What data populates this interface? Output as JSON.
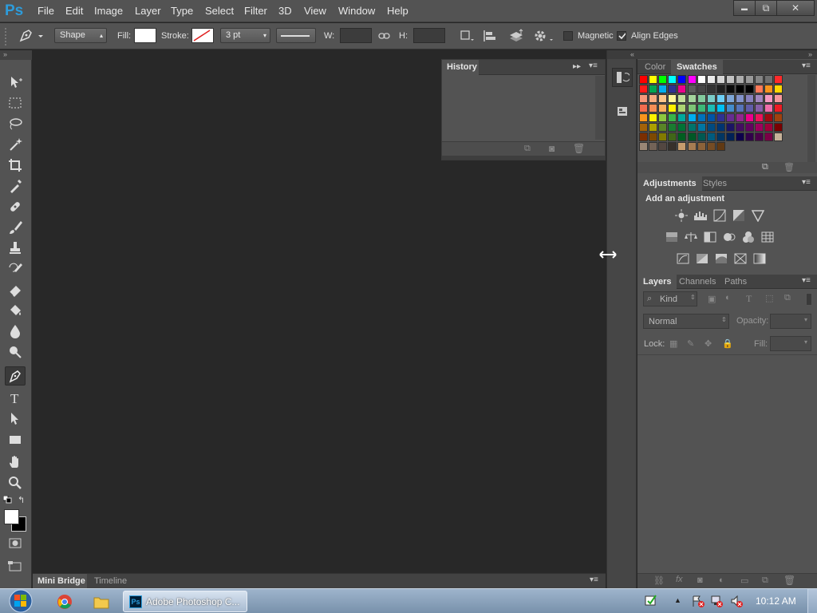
{
  "app": {
    "logo": "Ps"
  },
  "menu": [
    "File",
    "Edit",
    "Image",
    "Layer",
    "Type",
    "Select",
    "Filter",
    "3D",
    "View",
    "Window",
    "Help"
  ],
  "window_controls": {
    "minimize": "▬",
    "restore": "⧉",
    "close": "✕"
  },
  "options_bar": {
    "mode": "Shape",
    "fill_label": "Fill:",
    "stroke_label": "Stroke:",
    "stroke_width": "3 pt",
    "w_label": "W:",
    "h_label": "H:",
    "magnetic_label": "Magnetic",
    "magnetic_checked": false,
    "align_edges_label": "Align Edges",
    "align_edges_checked": true
  },
  "history_panel": {
    "tab": "History"
  },
  "color_panel": {
    "tabs": [
      "Color",
      "Swatches"
    ],
    "active": "Swatches"
  },
  "swatches": {
    "rows": [
      [
        "#ff0000",
        "#ffff00",
        "#00ff00",
        "#00ffff",
        "#0000ff",
        "#ff00ff",
        "#ffffff",
        "#ebebeb",
        "#d6d6d6",
        "#c2c2c2",
        "#adadad",
        "#999999",
        "#858585",
        "#707070",
        "#ff2a2a"
      ],
      [
        "#ff1a1a",
        "#00a651",
        "#00aeef",
        "#2e3192",
        "#ec008c",
        "#5c5c5c",
        "#474747",
        "#333333",
        "#1f1f1f",
        "#0a0a0a",
        "#000000",
        "#000000",
        "#ff7a59",
        "#f7941d",
        "#ffd700"
      ],
      [
        "#f7977a",
        "#f9ad81",
        "#fdc68a",
        "#fff79a",
        "#c4df9b",
        "#a3d39c",
        "#82ca9d",
        "#7accc8",
        "#6dcff6",
        "#7ea7d8",
        "#8393ca",
        "#8781bd",
        "#a187be",
        "#f49ac2",
        "#f6989d"
      ],
      [
        "#f26c4f",
        "#f68e56",
        "#fbaf5d",
        "#fff200",
        "#acd373",
        "#7cc576",
        "#3cb878",
        "#1cbbb4",
        "#00bff3",
        "#448ccb",
        "#5674b9",
        "#605ca8",
        "#855fa8",
        "#f06eaa",
        "#ed1c24"
      ],
      [
        "#f7941d",
        "#fff200",
        "#8dc73f",
        "#39b54a",
        "#00a99d",
        "#00aeef",
        "#0072bc",
        "#0054a6",
        "#2e3192",
        "#662d91",
        "#92278f",
        "#ec008c",
        "#ed145b",
        "#9e0b0f",
        "#a0410d"
      ],
      [
        "#a36209",
        "#aba000",
        "#598527",
        "#1a7b30",
        "#007236",
        "#00746b",
        "#0076a3",
        "#004a80",
        "#003471",
        "#1b1464",
        "#440e62",
        "#630460",
        "#9e005d",
        "#9e0039",
        "#790000"
      ],
      [
        "#7b2e00",
        "#7d4900",
        "#827b00",
        "#406618",
        "#005e20",
        "#005826",
        "#005952",
        "#005b7f",
        "#003663",
        "#002157",
        "#0d004c",
        "#32004b",
        "#4b0049",
        "#7b0046",
        "#c7b299"
      ],
      [
        "#998675",
        "#736357",
        "#534741",
        "#37302a",
        "#c69c6d",
        "#a67c52",
        "#8c6239",
        "#754c24",
        "#603913"
      ]
    ]
  },
  "adjustments_panel": {
    "tabs": [
      "Adjustments",
      "Styles"
    ],
    "heading": "Add an adjustment",
    "icons_row1": [
      "brightness-contrast-icon",
      "levels-icon",
      "curves-icon",
      "exposure-icon",
      "vibrance-icon"
    ],
    "icons_row2": [
      "hue-saturation-icon",
      "color-balance-icon",
      "black-white-icon",
      "photo-filter-icon",
      "channel-mixer-icon",
      "color-lookup-icon"
    ],
    "icons_row3": [
      "invert-icon",
      "posterize-icon",
      "threshold-icon",
      "selective-color-icon",
      "gradient-map-icon"
    ]
  },
  "layers_panel": {
    "tabs": [
      "Layers",
      "Channels",
      "Paths"
    ],
    "filter_kind": "Kind",
    "blend_mode": "Normal",
    "opacity_label": "Opacity:",
    "lock_label": "Lock:",
    "fill_label": "Fill:"
  },
  "bottom_bar": {
    "tabs": [
      "Mini Bridge",
      "Timeline"
    ]
  },
  "taskbar": {
    "task_label": "Adobe Photoshop C...",
    "clock": "10:12 AM"
  },
  "colors": {
    "ui_gray": "#535353",
    "canvas": "#282828",
    "accent_ps": "#2d9cdb"
  }
}
